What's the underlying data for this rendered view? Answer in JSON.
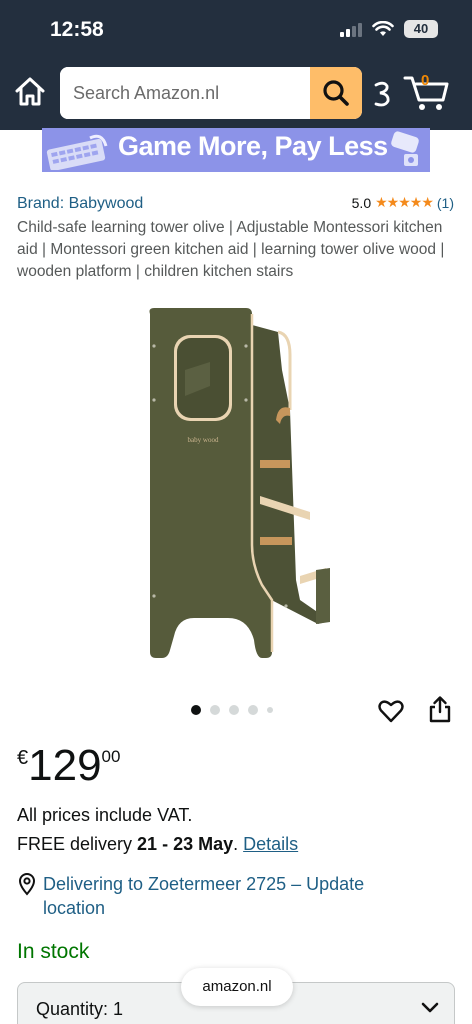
{
  "status_bar": {
    "time": "12:58",
    "battery": "40"
  },
  "header": {
    "search_placeholder": "Search Amazon.nl",
    "cart_count": "0",
    "colors": {
      "bar": "#232f3e",
      "search_button": "#febd69"
    }
  },
  "banner": {
    "text": "Game More, Pay Less"
  },
  "product": {
    "brand": "Brand: Babywood",
    "rating_value": "5.0",
    "stars": "★★★★★",
    "rating_count": "(1)",
    "title": "Child-safe learning tower olive | Adjustable Montessori kitchen aid | Montessori green kitchen aid | learning tower olive wood | wooden platform | children kitchen stairs",
    "image_logo": "baby wood",
    "image_count": 5,
    "active_image": 1
  },
  "price": {
    "symbol": "€",
    "whole": "129",
    "fraction": "00"
  },
  "vat_text": "All prices include VAT.",
  "delivery": {
    "prefix": "FREE delivery ",
    "dates": "21 - 23 May",
    "separator": ". ",
    "details_link": "Details"
  },
  "location": {
    "text": "Delivering to Zoetermeer 2725 – Update location"
  },
  "stock": {
    "text": "In stock",
    "color": "#007600"
  },
  "quantity": {
    "label": "Quantity: 1"
  },
  "browser": {
    "url": "amazon.nl"
  }
}
